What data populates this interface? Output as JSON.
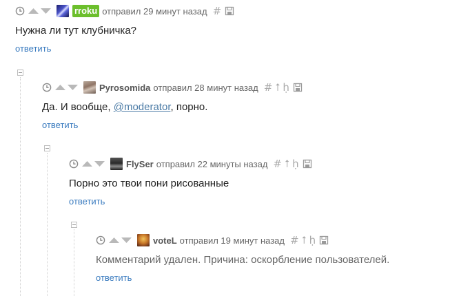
{
  "comments": [
    {
      "username": "rroku",
      "action": "отправил 29 минут назад",
      "text": "Нужна ли тут клубничка?",
      "reply": "ответить"
    },
    {
      "username": "Pyrosomida",
      "action": "отправил 28 минут назад",
      "text_before": "Да. И вообще, ",
      "mention": "@moderator",
      "text_after": ", порно.",
      "reply": "ответить"
    },
    {
      "username": "FlySer",
      "action": "отправил 22 минуты назад",
      "text": "Порно это твои пони рисованные",
      "reply": "ответить"
    },
    {
      "username": "voteL",
      "action": "отправил 19 минут назад",
      "text": "Комментарий удален. Причина: оскорбление пользователей.",
      "reply": "ответить"
    }
  ],
  "icons": {
    "hash": "#",
    "parent": "⭡",
    "thread": "ḥ"
  },
  "colors": {
    "link": "#3a7bbf",
    "mention": "#4a7aa5",
    "badge": "#6cbf2c",
    "meta": "#666666"
  }
}
